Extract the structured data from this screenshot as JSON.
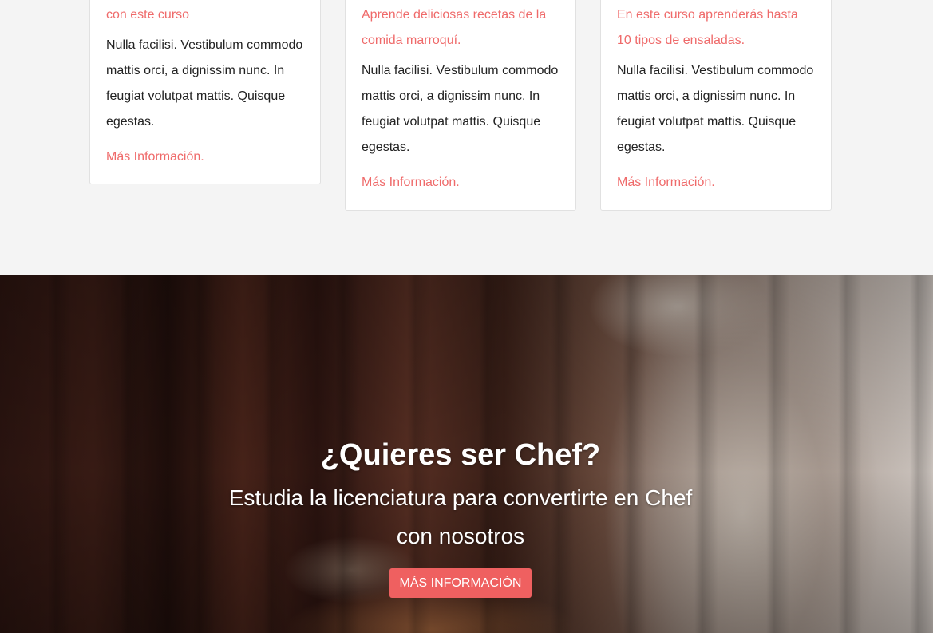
{
  "cards": [
    {
      "subtitle": "con este curso",
      "text": "Nulla facilisi. Vestibulum commodo mattis orci, a dignissim nunc. In feugiat volutpat mattis. Quisque egestas.",
      "link": "Más Información."
    },
    {
      "subtitle": "Aprende deliciosas recetas de la comida marroquí.",
      "text": "Nulla facilisi. Vestibulum commodo mattis orci, a dignissim nunc. In feugiat volutpat mattis. Quisque egestas.",
      "link": "Más Información."
    },
    {
      "subtitle": "En este curso aprenderás hasta 10 tipos de ensaladas.",
      "text": "Nulla facilisi. Vestibulum commodo mattis orci, a dignissim nunc. In feugiat volutpat mattis. Quisque egestas.",
      "link": "Más Información."
    }
  ],
  "hero": {
    "title": "¿Quieres ser Chef?",
    "subtitle": "Estudia la licenciatura para convertirte en Chef con nosotros",
    "button_label": "MÁS INFORMACIÓN"
  },
  "colors": {
    "accent": "#ef6a6a",
    "button": "#ef6060",
    "section_bg": "#f4f4f4",
    "card_bg": "#ffffff"
  }
}
